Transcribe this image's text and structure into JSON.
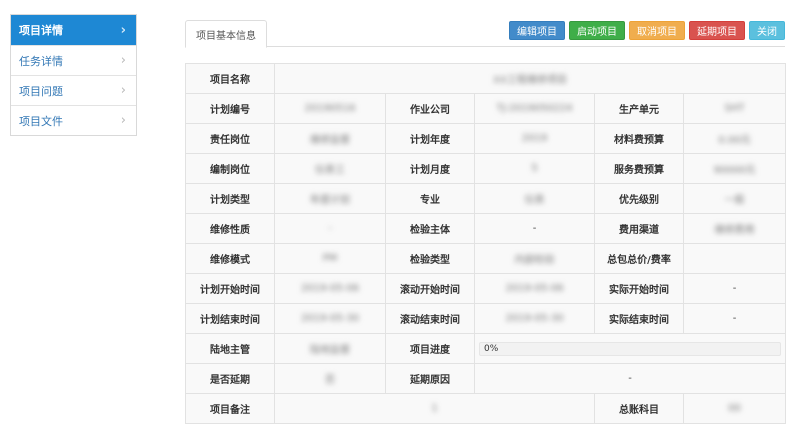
{
  "sidebar": {
    "items": [
      {
        "label": "项目详情",
        "active": true
      },
      {
        "label": "任务详情",
        "active": false
      },
      {
        "label": "项目问题",
        "active": false
      },
      {
        "label": "项目文件",
        "active": false
      }
    ]
  },
  "tab": {
    "label": "项目基本信息"
  },
  "actions": {
    "edit": "编辑项目",
    "start": "启动项目",
    "cancel": "取消项目",
    "delay": "延期项目",
    "close": "关闭"
  },
  "info": {
    "project_name_label": "项目名称",
    "project_name_value": "XX工程维修项目",
    "plan_no_label": "计划编号",
    "plan_no_value": "20190516",
    "company_label": "作业公司",
    "company_value": "TJ-2019050224",
    "unit_label": "生产单元",
    "unit_value": "SHT",
    "role_label": "责任岗位",
    "role_value": "维修监督",
    "plan_year_label": "计划年度",
    "plan_year_value": "2019",
    "material_budget_label": "材料费预算",
    "material_budget_value": "0.00元",
    "author_label": "编制岗位",
    "author_value": "仪表工",
    "plan_month_label": "计划月度",
    "plan_month_value": "5",
    "service_budget_label": "服务费预算",
    "service_budget_value": "90000元",
    "plan_type_label": "计划类型",
    "plan_type_value": "年度计划",
    "major_label": "专业",
    "major_value": "仪表",
    "priority_label": "优先级别",
    "priority_value": "一般",
    "nature_label": "维修性质",
    "nature_value": "-",
    "inspector_label": "检验主体",
    "inspector_value": "-",
    "channel_label": "费用渠道",
    "channel_value": "维修费用",
    "mode_label": "维修模式",
    "mode_value": "PM",
    "inspect_type_label": "检验类型",
    "inspect_type_value": "内部检验",
    "total_price_label": "总包总价/费率",
    "total_price_value": "",
    "plan_start_label": "计划开始时间",
    "plan_start_value": "2019-05-06",
    "roll_start_label": "滚动开始时间",
    "roll_start_value": "2019-05-06",
    "actual_start_label": "实际开始时间",
    "actual_start_value": "-",
    "plan_end_label": "计划结束时间",
    "plan_end_value": "2019-05-30",
    "roll_end_label": "滚动结束时间",
    "roll_end_value": "2019-05-30",
    "actual_end_label": "实际结束时间",
    "actual_end_value": "-",
    "supervisor_label": "陆地主管",
    "supervisor_value": "陆地监督",
    "progress_label": "项目进度",
    "progress_value": "0%",
    "delayed_label": "是否延期",
    "delayed_value": "否",
    "delay_reason_label": "延期原因",
    "delay_reason_value": "-",
    "remark_label": "项目备注",
    "remark_value": "1",
    "ledger_label": "总账科目",
    "ledger_value": "00"
  }
}
